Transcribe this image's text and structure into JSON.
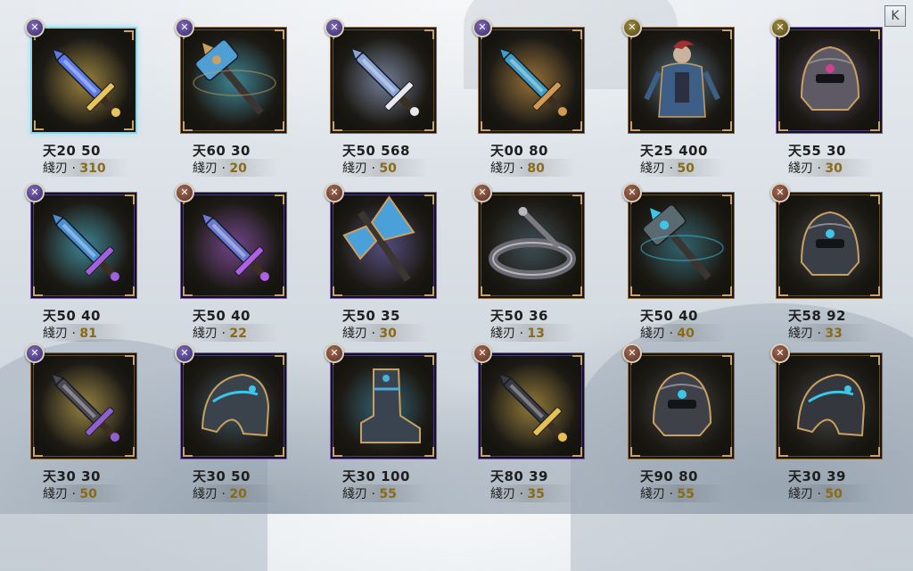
{
  "ui": {
    "close_icon": "K"
  },
  "items": [
    {
      "label1": "天20 50",
      "label2_prefix": "綫刃 · ",
      "label2_value": "310",
      "badge": "purple",
      "frame": "selected",
      "glow": "#e7c24a",
      "icon": "glowing-blue-sword-icon",
      "main": "#5a7be8",
      "accent": "#e8c45a"
    },
    {
      "label1": "天60 30",
      "label2_prefix": "綫刃 · ",
      "label2_value": "20",
      "badge": "purple",
      "frame": "gold",
      "glow": "#3ec6e8",
      "icon": "blue-hammer-icon",
      "main": "#4f9fd4",
      "accent": "#c8a060"
    },
    {
      "label1": "天50 568",
      "label2_prefix": "綫刃 · ",
      "label2_value": "50",
      "badge": "purple",
      "frame": "gold",
      "glow": "#9fb8e8",
      "icon": "crystal-sword-icon",
      "main": "#8aa5d8",
      "accent": "#e8e8f0"
    },
    {
      "label1": "天00 80",
      "label2_prefix": "綫刃 · ",
      "label2_value": "80",
      "badge": "purple",
      "frame": "gold",
      "glow": "#e0a040",
      "icon": "dagger-icon",
      "main": "#3ea0c8",
      "accent": "#d09a50"
    },
    {
      "label1": "天25 400",
      "label2_prefix": "綫刃 · ",
      "label2_value": "50",
      "badge": "olive",
      "frame": "gold",
      "glow": "#6aa0c8",
      "icon": "armored-warrior-icon",
      "main": "#3d5e86",
      "accent": "#a03030"
    },
    {
      "label1": "天55 30",
      "label2_prefix": "綫刃 · ",
      "label2_value": "30",
      "badge": "olive",
      "frame": "purple",
      "glow": "#7a6ab0",
      "icon": "helmet-mace-icon",
      "main": "#5d5a66",
      "accent": "#d04090"
    },
    {
      "label1": "天50 40",
      "label2_prefix": "綫刃 · ",
      "label2_value": "81",
      "badge": "purple",
      "frame": "purple",
      "glow": "#3ec6e8",
      "icon": "lightning-sword-icon",
      "main": "#4a8fd0",
      "accent": "#a060e0"
    },
    {
      "label1": "天50 40",
      "label2_prefix": "綫刃 · ",
      "label2_value": "22",
      "badge": "brown",
      "frame": "purple",
      "glow": "#a050d8",
      "icon": "violet-sword-icon",
      "main": "#6a7ad0",
      "accent": "#b060e8"
    },
    {
      "label1": "天50 35",
      "label2_prefix": "綫刃 · ",
      "label2_value": "30",
      "badge": "brown",
      "frame": "purple",
      "glow": "#6a60c0",
      "icon": "crystal-axe-icon",
      "main": "#4aa0d8",
      "accent": "#d0a060"
    },
    {
      "label1": "天50 36",
      "label2_prefix": "綫刃 · ",
      "label2_value": "13",
      "badge": "brown",
      "frame": "gold",
      "glow": "#406070",
      "icon": "crown-ring-icon",
      "main": "#6a6a70",
      "accent": "#b8b8c0"
    },
    {
      "label1": "天50 40",
      "label2_prefix": "綫刃 · ",
      "label2_value": "40",
      "badge": "brown",
      "frame": "gold",
      "glow": "#2a8aa0",
      "icon": "spiked-mace-icon",
      "main": "#5a6a70",
      "accent": "#3ec6e8"
    },
    {
      "label1": "天58 92",
      "label2_prefix": "綫刃 · ",
      "label2_value": "33",
      "badge": "brown",
      "frame": "gold",
      "glow": "#50606a",
      "icon": "dark-helmet-icon",
      "main": "#3a3e46",
      "accent": "#3ec6e8"
    },
    {
      "label1": "天30 30",
      "label2_prefix": "綫刃 · ",
      "label2_value": "50",
      "badge": "purple",
      "frame": "gold",
      "glow": "#e0c050",
      "icon": "gold-sword-icon",
      "main": "#4a4850",
      "accent": "#9060d0"
    },
    {
      "label1": "天30 50",
      "label2_prefix": "綫刃 · ",
      "label2_value": "20",
      "badge": "purple",
      "frame": "purple",
      "glow": "#3a7090",
      "icon": "pauldron-icon",
      "main": "#3a424c",
      "accent": "#3ec6e8"
    },
    {
      "label1": "天30 100",
      "label2_prefix": "綫刃 · ",
      "label2_value": "55",
      "badge": "brown",
      "frame": "purple",
      "glow": "#2a8ab0",
      "icon": "boot-icon",
      "main": "#3a4450",
      "accent": "#4ab0d8"
    },
    {
      "label1": "天80 39",
      "label2_prefix": "綫刃 · ",
      "label2_value": "35",
      "badge": "brown",
      "frame": "purple",
      "glow": "#d8b040",
      "icon": "golden-blade-icon",
      "main": "#3a3c44",
      "accent": "#e8c050"
    },
    {
      "label1": "天90 80",
      "label2_prefix": "綫刃 · ",
      "label2_value": "55",
      "badge": "brown",
      "frame": "gold",
      "glow": "#4a5058",
      "icon": "gauntlet-helm-icon",
      "main": "#3e4148",
      "accent": "#3ec6e8"
    },
    {
      "label1": "天30 39",
      "label2_prefix": "綫刃 · ",
      "label2_value": "50",
      "badge": "brown",
      "frame": "gold",
      "glow": "#4a5058",
      "icon": "shoulder-armor-icon",
      "main": "#34373e",
      "accent": "#3ec6e8"
    }
  ]
}
